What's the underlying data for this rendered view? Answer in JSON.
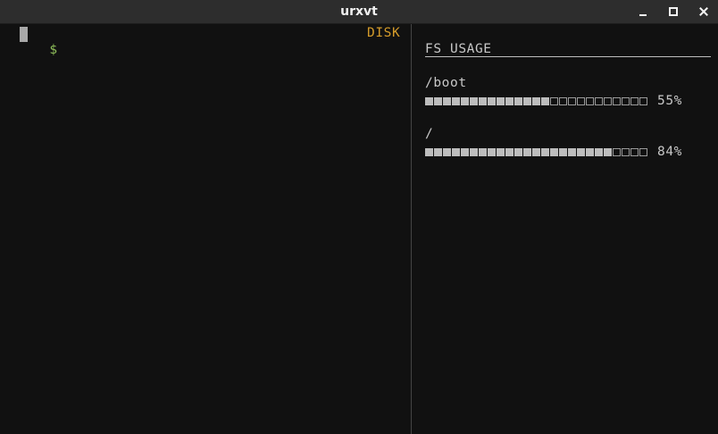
{
  "window": {
    "title": "urxvt",
    "controls": {
      "minimize": "minimize-icon",
      "maximize": "maximize-icon",
      "close": "close-icon"
    }
  },
  "terminal": {
    "prompt": "$",
    "input": "",
    "pane_label": "DISK"
  },
  "fs_panel": {
    "title": "FS USAGE",
    "mounts": [
      {
        "name": "/boot",
        "percent": "55%",
        "used_fraction": 0.55,
        "segments": 25
      },
      {
        "name": "/",
        "percent": "84%",
        "used_fraction": 0.84,
        "segments": 25
      }
    ]
  },
  "colors": {
    "background": "#111111",
    "titlebar": "#2d2d2d",
    "prompt": "#8fbf5a",
    "pane_label": "#d49b2a",
    "text": "#c8c8c8"
  }
}
